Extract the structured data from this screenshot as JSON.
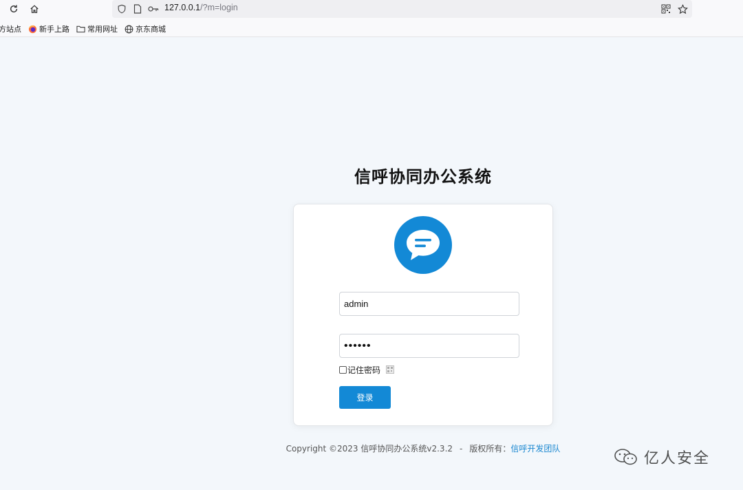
{
  "browser": {
    "url_host": "127.0.0.1",
    "url_rest": "/?m=login",
    "bookmarks": [
      {
        "label": "方站点",
        "icon": "none"
      },
      {
        "label": "新手上路",
        "icon": "firefox-icon"
      },
      {
        "label": "常用网址",
        "icon": "folder-icon"
      },
      {
        "label": "京东商城",
        "icon": "globe-icon"
      }
    ]
  },
  "page": {
    "title": "信呼协同办公系统",
    "logo_icon": "chat-bubble-icon",
    "username_value": "admin",
    "password_value": "••••••",
    "remember_label": "记住密码",
    "login_button": "登录",
    "footer": {
      "copyright": "Copyright ©2023 信呼协同办公系统v2.3.2",
      "separator": "-",
      "rights_label": "版权所有：",
      "rights_link": "信呼开发团队"
    },
    "watermark": "亿人安全"
  },
  "colors": {
    "accent": "#1389d6",
    "background": "#f3f7fb",
    "link": "#1a87d0"
  }
}
